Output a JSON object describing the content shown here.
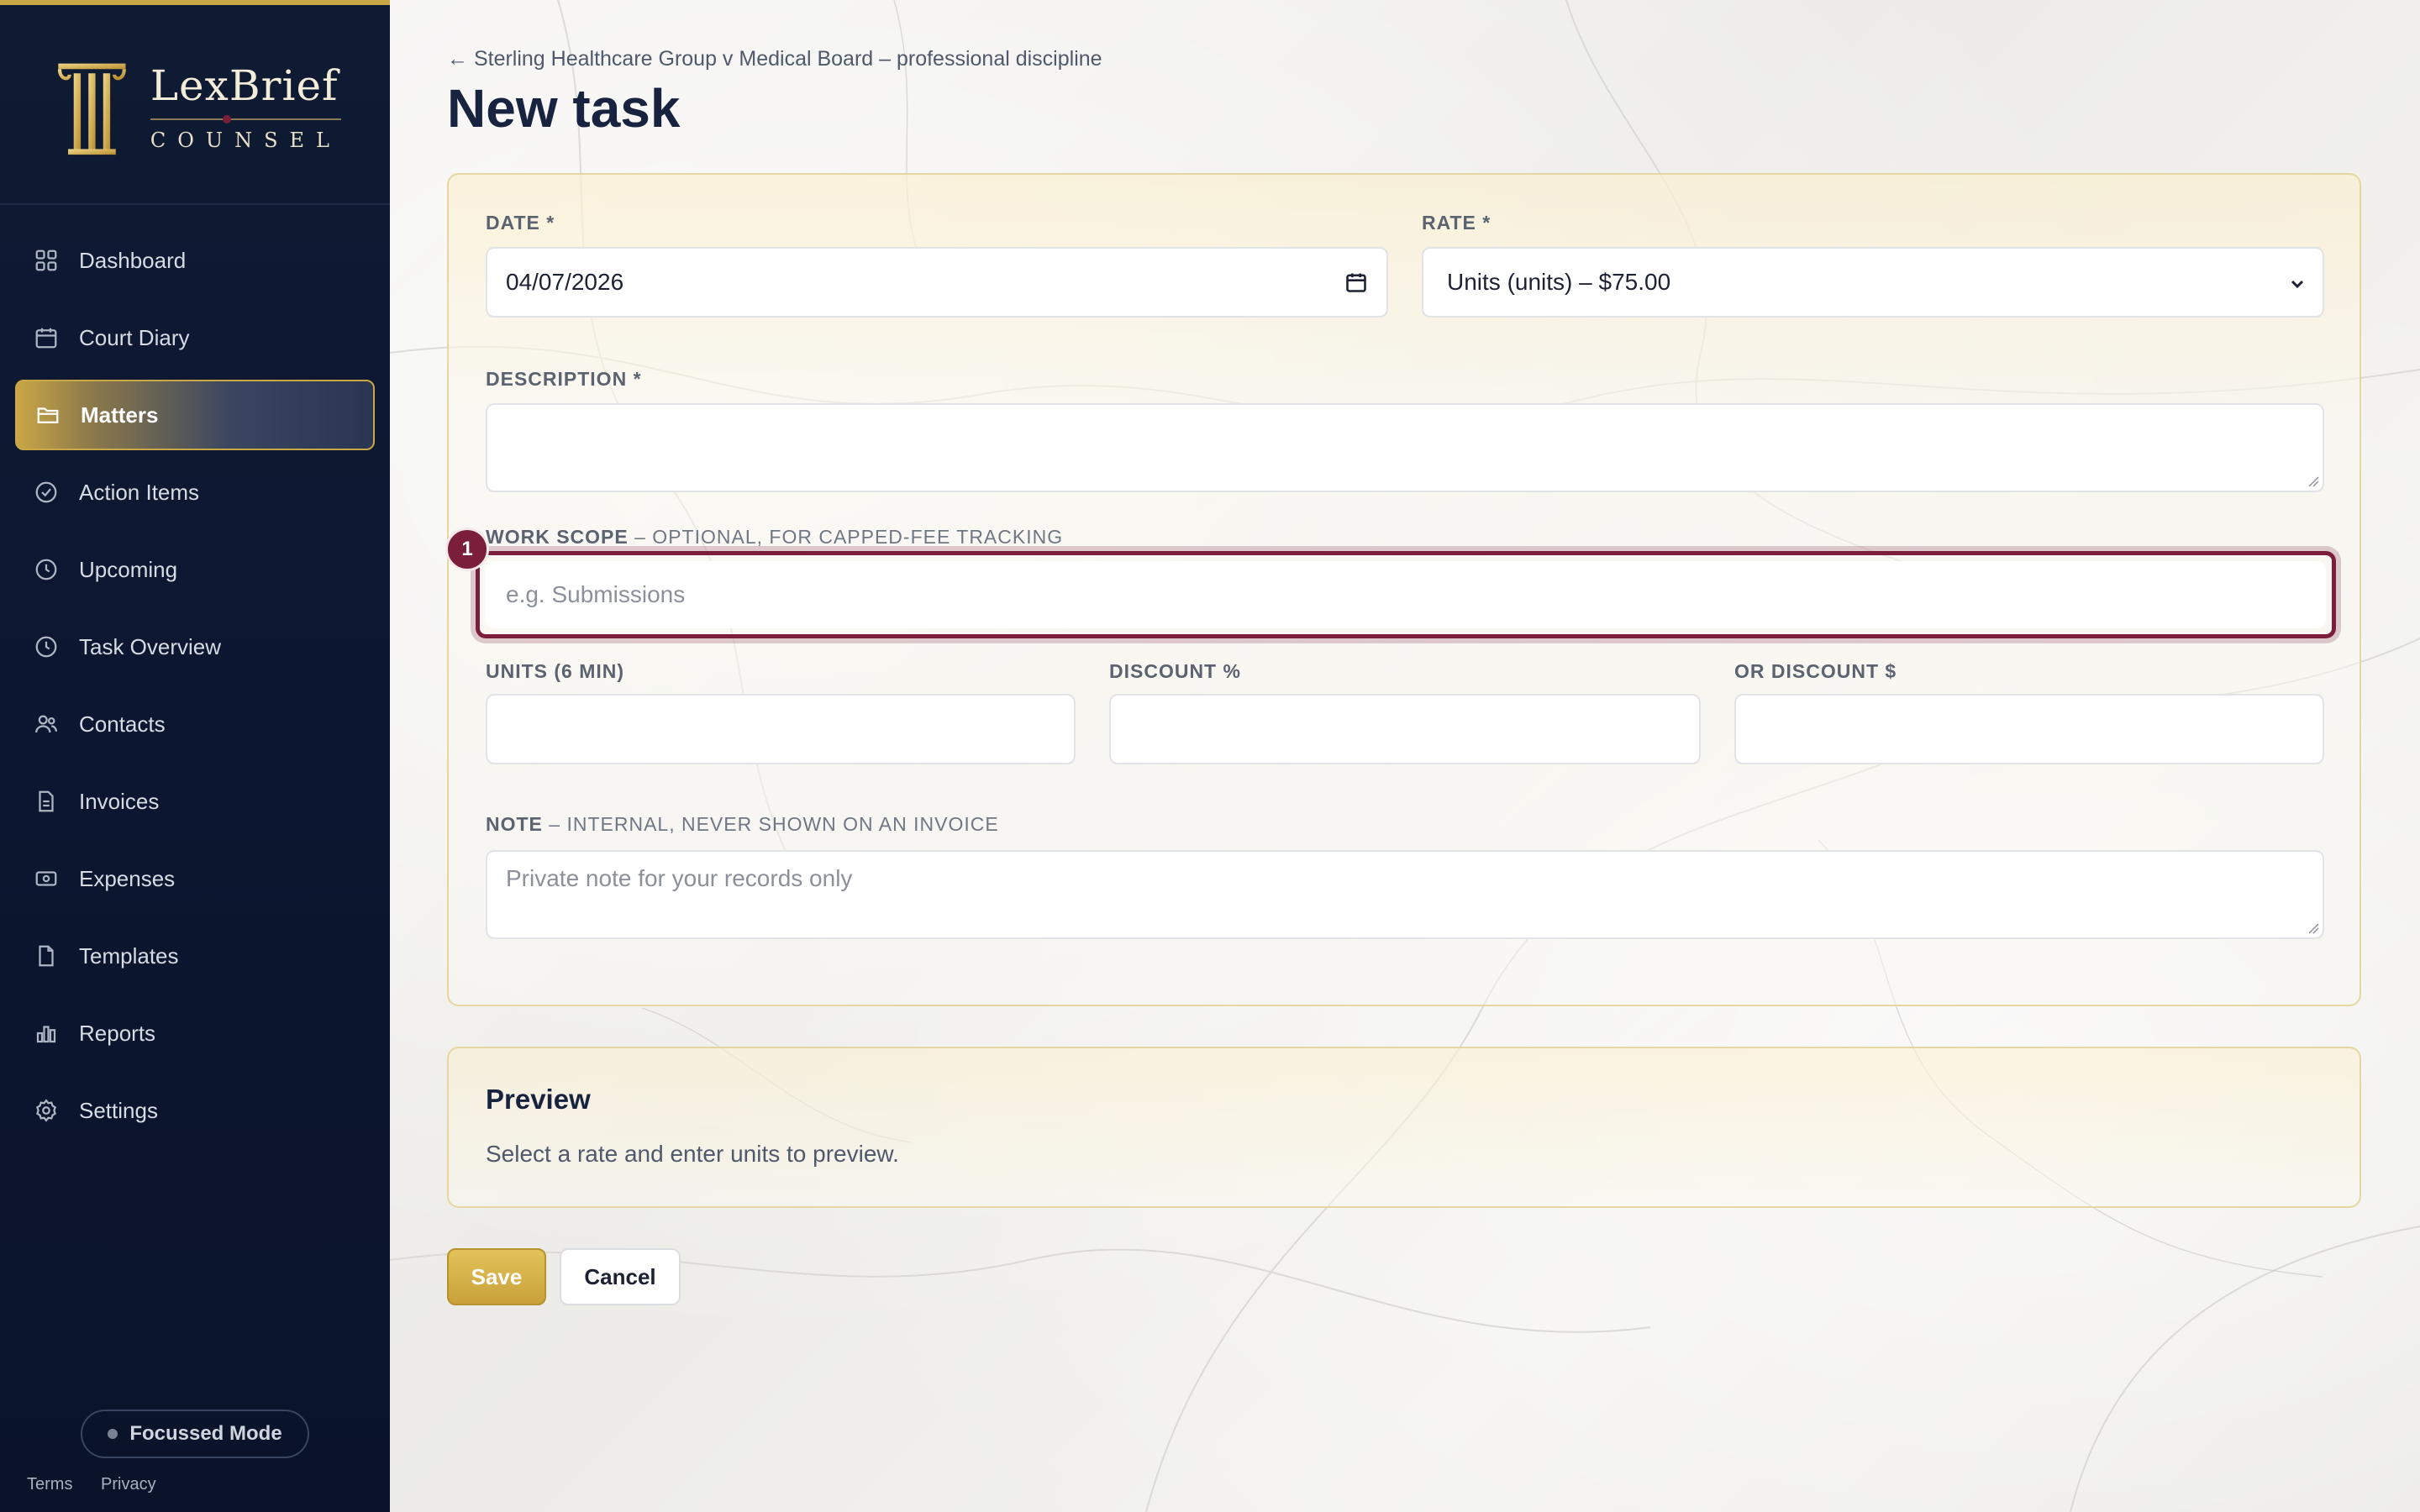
{
  "brand": {
    "name": "LexBrief",
    "subtitle": "COUNSEL"
  },
  "sidebar": {
    "items": [
      {
        "label": "Dashboard",
        "icon": "grid-icon"
      },
      {
        "label": "Court Diary",
        "icon": "calendar-icon"
      },
      {
        "label": "Matters",
        "icon": "folder-icon",
        "active": true
      },
      {
        "label": "Action Items",
        "icon": "check-circle-icon"
      },
      {
        "label": "Upcoming",
        "icon": "clock-icon"
      },
      {
        "label": "Task Overview",
        "icon": "clock-icon"
      },
      {
        "label": "Contacts",
        "icon": "users-icon"
      },
      {
        "label": "Invoices",
        "icon": "document-icon"
      },
      {
        "label": "Expenses",
        "icon": "banknote-icon"
      },
      {
        "label": "Templates",
        "icon": "file-icon"
      },
      {
        "label": "Reports",
        "icon": "bar-chart-icon"
      },
      {
        "label": "Settings",
        "icon": "gear-icon"
      }
    ],
    "focus_mode_label": "Focussed Mode",
    "footer_links": [
      "Terms",
      "Privacy"
    ]
  },
  "page": {
    "breadcrumb": "← Sterling Healthcare Group v Medical Board – professional discipline",
    "title": "New task"
  },
  "form": {
    "date": {
      "label": "DATE *",
      "value": "04/07/2026"
    },
    "rate": {
      "label": "RATE *",
      "value": "Units (units) – $75.00"
    },
    "description": {
      "label": "DESCRIPTION *",
      "value": ""
    },
    "work_scope": {
      "label": "WORK SCOPE",
      "label_hint": "– OPTIONAL, FOR CAPPED-FEE TRACKING",
      "placeholder": "e.g. Submissions",
      "badge": "1"
    },
    "units": {
      "label": "UNITS (6 MIN)",
      "value": ""
    },
    "discount_pct": {
      "label": "DISCOUNT %",
      "value": ""
    },
    "discount_amt": {
      "label": "OR DISCOUNT $",
      "value": ""
    },
    "note": {
      "label": "NOTE",
      "label_hint": "– INTERNAL, NEVER SHOWN ON AN INVOICE",
      "placeholder": "Private note for your records only"
    }
  },
  "preview": {
    "title": "Preview",
    "message": "Select a rate and enter units to preview."
  },
  "actions": {
    "save": "Save",
    "cancel": "Cancel"
  },
  "colors": {
    "accent_gold": "#c9a646",
    "focus_maroon": "#7b1e3a",
    "sidebar_navy": "#0f1a33"
  }
}
